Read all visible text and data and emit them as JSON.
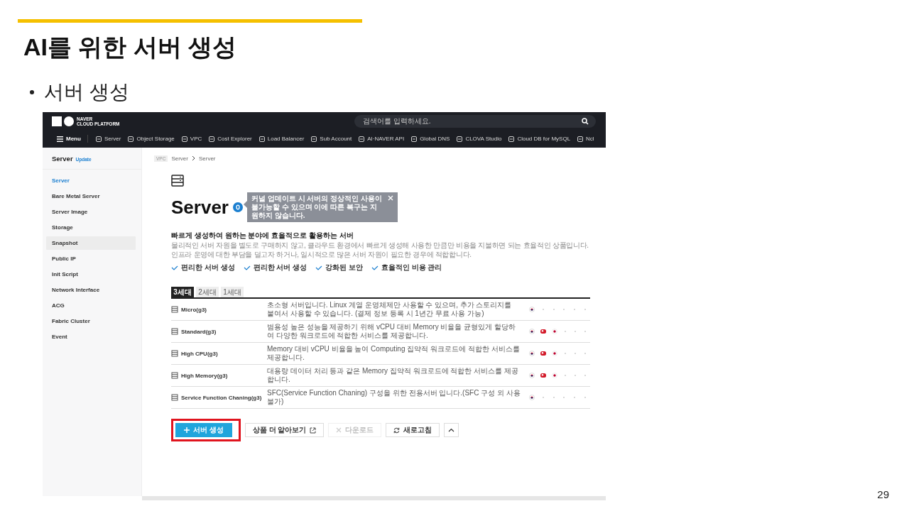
{
  "slide": {
    "title": "AI를 위한 서버 생성",
    "bullet": "서버 생성",
    "page_number": "29"
  },
  "header": {
    "logo_line1": "NAVER",
    "logo_line2": "CLOUD PLATFORM",
    "search": {
      "placeholder": "검색어를 입력하세요."
    },
    "menu_label": "Menu",
    "nav": [
      "Server",
      "Object Storage",
      "VPC",
      "Cost Explorer",
      "Load Balancer",
      "Sub Account",
      "AI·NAVER API",
      "Global DNS",
      "CLOVA Studio",
      "Cloud DB for MySQL",
      "Ncl"
    ]
  },
  "sidebar": {
    "title": "Server",
    "badge": "Update",
    "items": [
      {
        "label": "Server",
        "selected": true,
        "highlighted": false
      },
      {
        "label": "Bare Metal Server",
        "selected": false,
        "highlighted": false
      },
      {
        "label": "Server Image",
        "selected": false,
        "highlighted": false
      },
      {
        "label": "Storage",
        "selected": false,
        "highlighted": false
      },
      {
        "label": "Snapshot",
        "selected": false,
        "highlighted": true
      },
      {
        "label": "Public IP",
        "selected": false,
        "highlighted": false
      },
      {
        "label": "Init Script",
        "selected": false,
        "highlighted": false
      },
      {
        "label": "Network Interface",
        "selected": false,
        "highlighted": false
      },
      {
        "label": "ACG",
        "selected": false,
        "highlighted": false
      },
      {
        "label": "Fabric Cluster",
        "selected": false,
        "highlighted": false
      },
      {
        "label": "Event",
        "selected": false,
        "highlighted": false
      }
    ]
  },
  "content": {
    "breadcrumb": {
      "tag": "VPC",
      "path": [
        "Server",
        "Server"
      ]
    },
    "title": "Server",
    "tooltip": "커널 업데이트 시 서버의 정상적인 사용이 불가능할 수 있으며 이에 따른 복구는 지원하지 않습니다.",
    "heading": "빠르게 생성하여 원하는 분야에 효율적으로 활용하는 서버",
    "description": [
      "물리적인 서버 자원을 별도로 구매하지 않고, 클라우드 환경에서 빠르게 생성해 사용한 만큼만 비용을 지불하면 되는 효율적인 상품입니다.",
      "인프라 운영에 대한 부담을 덜고자 하거나, 일시적으로 많은 서버 자원이 필요한 경우에 적합합니다."
    ],
    "features": [
      "편리한 서버 생성",
      "편리한 서버 생성",
      "강화된 보안",
      "효율적인 비용 관리"
    ],
    "tabs": [
      {
        "label": "3세대",
        "selected": true
      },
      {
        "label": "2세대",
        "selected": false
      },
      {
        "label": "1세대",
        "selected": false
      }
    ],
    "rows": [
      {
        "name": "Micro(g3)",
        "description": "초소형 서버입니다. Linux 계열 운영체제만 사용할 수 있으며, 추가 스토리지를 붙여서 사용할 수 있습니다. (결제 정보 등록 시 1년간 무료 사용 가능)",
        "regions": [
          true,
          false,
          false,
          false,
          false,
          false
        ]
      },
      {
        "name": "Standard(g3)",
        "description": "범용성 높은 성능을 제공하기 위해 vCPU 대비 Memory 비율을 균형있게 할당하여 다양한 워크로드에 적합한 서비스를 제공합니다.",
        "regions": [
          true,
          true,
          true,
          false,
          false,
          false
        ]
      },
      {
        "name": "High CPU(g3)",
        "description": "Memory 대비 vCPU 비율을 높여 Computing 집약적 워크로드에 적합한 서비스를 제공합니다.",
        "regions": [
          true,
          true,
          true,
          false,
          false,
          false
        ]
      },
      {
        "name": "High Memory(g3)",
        "description": "대용량 데이터 처리 등과 같은 Memory 집약적 워크로드에 적합한 서비스를 제공합니다.",
        "regions": [
          true,
          true,
          true,
          false,
          false,
          false
        ]
      },
      {
        "name": "Service Function Chaning(g3)",
        "description": "SFC(Service Function Chaning) 구성을 위한 전용서버 입니다.(SFC 구성 외 사용 불가)",
        "regions": [
          true,
          false,
          false,
          false,
          false,
          false
        ]
      }
    ],
    "buttons": [
      {
        "kind": "primary",
        "label": "서버 생성",
        "highlighted": true
      },
      {
        "kind": "external",
        "label": "상품 더 알아보기",
        "highlighted": false
      },
      {
        "kind": "disabled",
        "label": "다운로드",
        "highlighted": false
      },
      {
        "kind": "refresh",
        "label": "새로고침",
        "highlighted": false
      },
      {
        "kind": "collapse",
        "highlighted": false
      }
    ]
  }
}
